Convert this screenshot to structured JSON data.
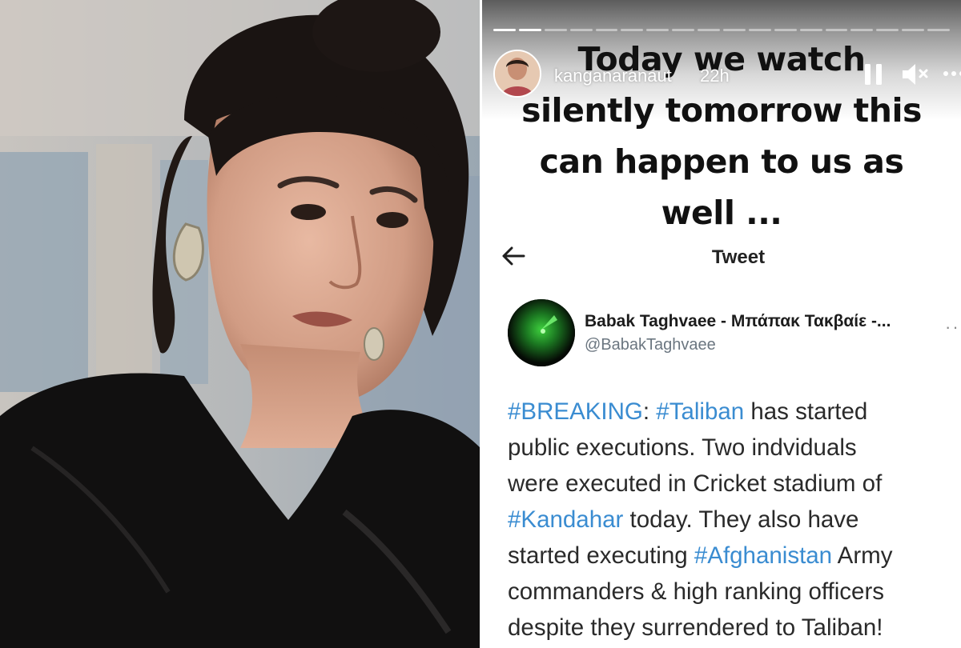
{
  "story": {
    "username": "kanganaranaut",
    "time_ago": "22h",
    "caption_lines": [
      "Today we watch",
      "silently tomorrow this",
      "can happen to us as",
      "well ..."
    ]
  },
  "tweet": {
    "nav_title": "Tweet",
    "author_name": "Babak Taghvaee - Μπάπακ Τακβαίε -...",
    "author_handle": "@BabakTaghvaee",
    "more": "··",
    "text": {
      "l1_tag1": "#BREAKING",
      "l1_sep": ": ",
      "l1_tag2": "#Taliban",
      "l1_rest": " has started",
      "l2": "public executions. Two indviduals",
      "l3": "were executed in Cricket stadium of",
      "l4_tag": "#Kandahar",
      "l4_rest": " today. They also have",
      "l5_pre": "started executing ",
      "l5_tag": "#Afghanistan",
      "l5_rest": " Army",
      "l6": "commanders & high ranking officers",
      "l7": "despite they surrendered to Taliban!"
    }
  },
  "colors": {
    "hashtag": "#3a8cd1",
    "caption_text": "#111111",
    "handle": "#6b7680"
  },
  "icons": [
    "back-arrow-icon",
    "pause-icon",
    "mute-icon",
    "more-icon"
  ]
}
